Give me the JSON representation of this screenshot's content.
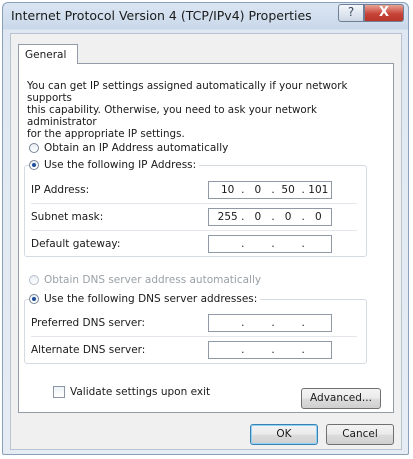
{
  "window": {
    "title": "Internet Protocol Version 4 (TCP/IPv4) Properties",
    "help_label": "?",
    "close_label": "X"
  },
  "tabs": [
    {
      "label": "General",
      "active": true
    }
  ],
  "intro_text": "You can get IP settings assigned automatically if your network supports\nthis capability. Otherwise, you need to ask your network administrator\nfor the appropriate IP settings.",
  "ip_section": {
    "auto_label": "Obtain an IP Address automatically",
    "auto_selected": false,
    "manual_label": "Use the following IP Address:",
    "manual_selected": true,
    "fields": [
      {
        "label": "IP Address:",
        "octets": [
          "10",
          "0",
          "50",
          "101"
        ]
      },
      {
        "label": "Subnet mask:",
        "octets": [
          "255",
          "0",
          "0",
          "0"
        ]
      },
      {
        "label": "Default gateway:",
        "octets": [
          "",
          "",
          "",
          ""
        ]
      }
    ]
  },
  "dns_section": {
    "auto_label": "Obtain DNS server address automatically",
    "auto_enabled": false,
    "manual_label": "Use the following DNS server addresses:",
    "manual_selected": true,
    "fields": [
      {
        "label": "Preferred DNS server:",
        "octets": [
          "",
          "",
          "",
          ""
        ]
      },
      {
        "label": "Alternate DNS server:",
        "octets": [
          "",
          "",
          "",
          ""
        ]
      }
    ]
  },
  "validate_label": "Validate settings upon exit",
  "validate_checked": false,
  "buttons": {
    "advanced": "Advanced...",
    "ok": "OK",
    "cancel": "Cancel"
  }
}
